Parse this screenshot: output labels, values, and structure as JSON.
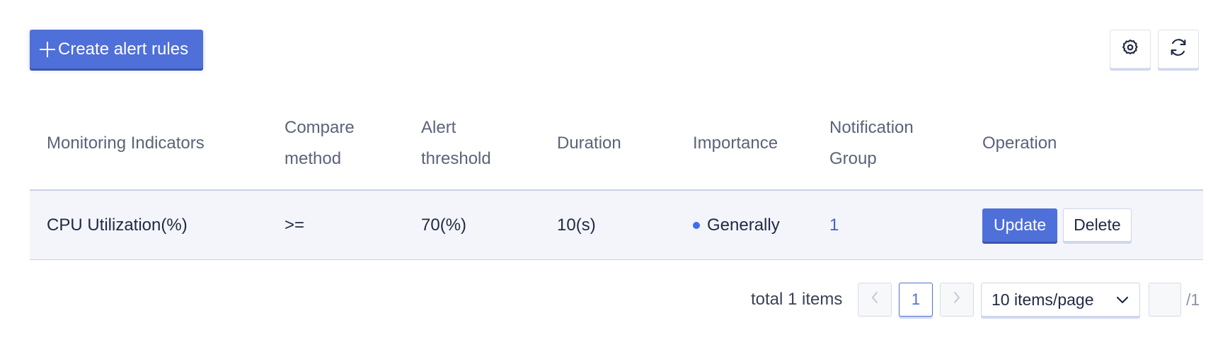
{
  "toolbar": {
    "create_label": "Create alert rules",
    "settings_icon": "gear-icon",
    "refresh_icon": "refresh-icon"
  },
  "table": {
    "headers": {
      "indicator_line1": "Monitoring Indicators",
      "compare_line1": "Compare",
      "compare_line2": "method",
      "threshold_line1": "Alert",
      "threshold_line2": "threshold",
      "duration_line1": "Duration",
      "importance_line1": "Importance",
      "group_line1": "Notification",
      "group_line2": "Group",
      "operation_line1": "Operation"
    },
    "rows": [
      {
        "indicator": "CPU Utilization(%)",
        "compare": ">=",
        "threshold": "70(%)",
        "duration": "10(s)",
        "importance": "Generally",
        "importance_color": "#3d6ef0",
        "group": "1",
        "update_label": "Update",
        "delete_label": "Delete"
      }
    ]
  },
  "pagination": {
    "total_text": "total 1 items",
    "current_page": "1",
    "page_size": "10 items/page",
    "jump_value": "",
    "total_pages": "/1"
  },
  "colors": {
    "primary": "#4f6fd9",
    "link": "#3d62d6",
    "row_bg": "#f4f5fa"
  }
}
